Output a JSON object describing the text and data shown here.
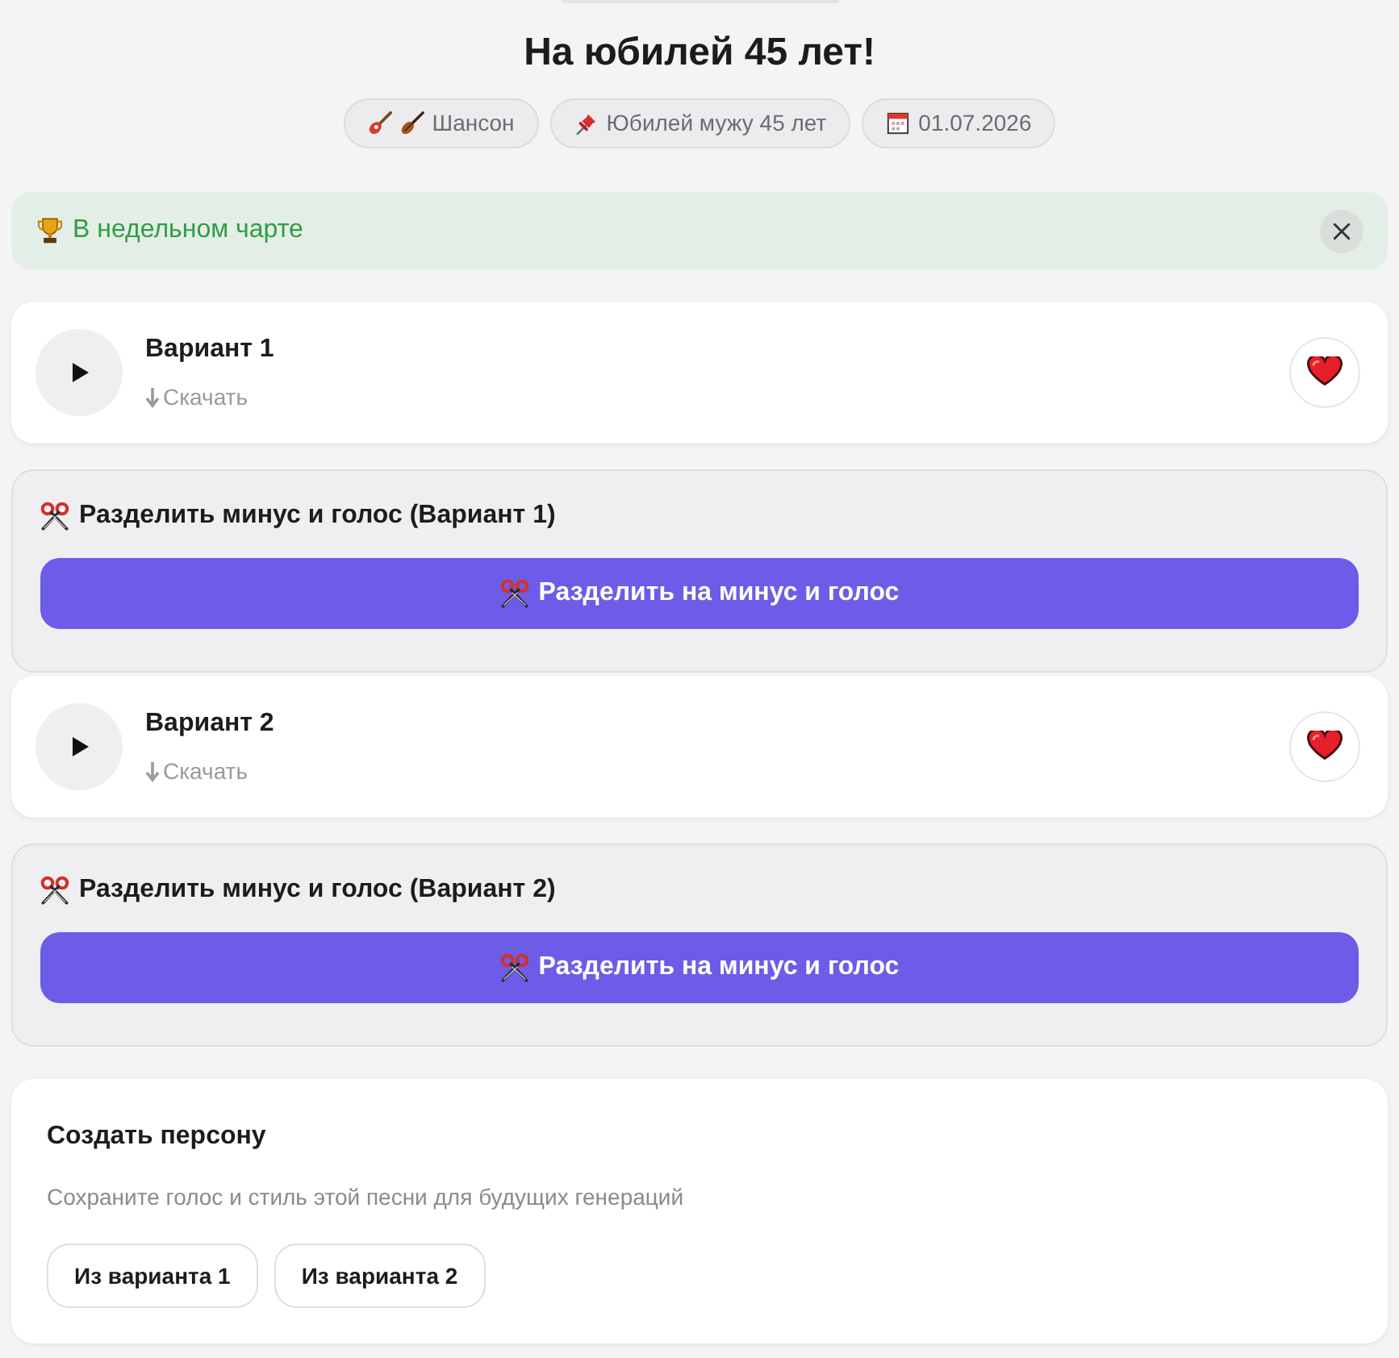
{
  "title": "На юбилей 45 лет!",
  "tags": [
    {
      "icons": [
        {
          "kind": "guitar"
        },
        {
          "kind": "violin"
        }
      ],
      "label": "Шансон"
    },
    {
      "icons": [
        {
          "kind": "pushpin"
        }
      ],
      "label": "Юбилей мужу 45 лет"
    },
    {
      "icons": [
        {
          "kind": "calendar"
        }
      ],
      "label": "01.07.2026"
    }
  ],
  "chart_banner": {
    "text": "В недельном чарте"
  },
  "variants": [
    {
      "title": "Вариант 1",
      "download": "Скачать",
      "liked": true,
      "split": {
        "heading": "Разделить минус и голос (Вариант 1)",
        "button": "Разделить на минус и голос"
      }
    },
    {
      "title": "Вариант 2",
      "download": "Скачать",
      "liked": true,
      "split": {
        "heading": "Разделить минус и голос (Вариант 2)",
        "button": "Разделить на минус и голос"
      }
    }
  ],
  "persona": {
    "title": "Создать персону",
    "description": "Сохраните голос и стиль этой песни для будущих генераций",
    "buttons": [
      "Из варианта 1",
      "Из варианта 2"
    ]
  }
}
